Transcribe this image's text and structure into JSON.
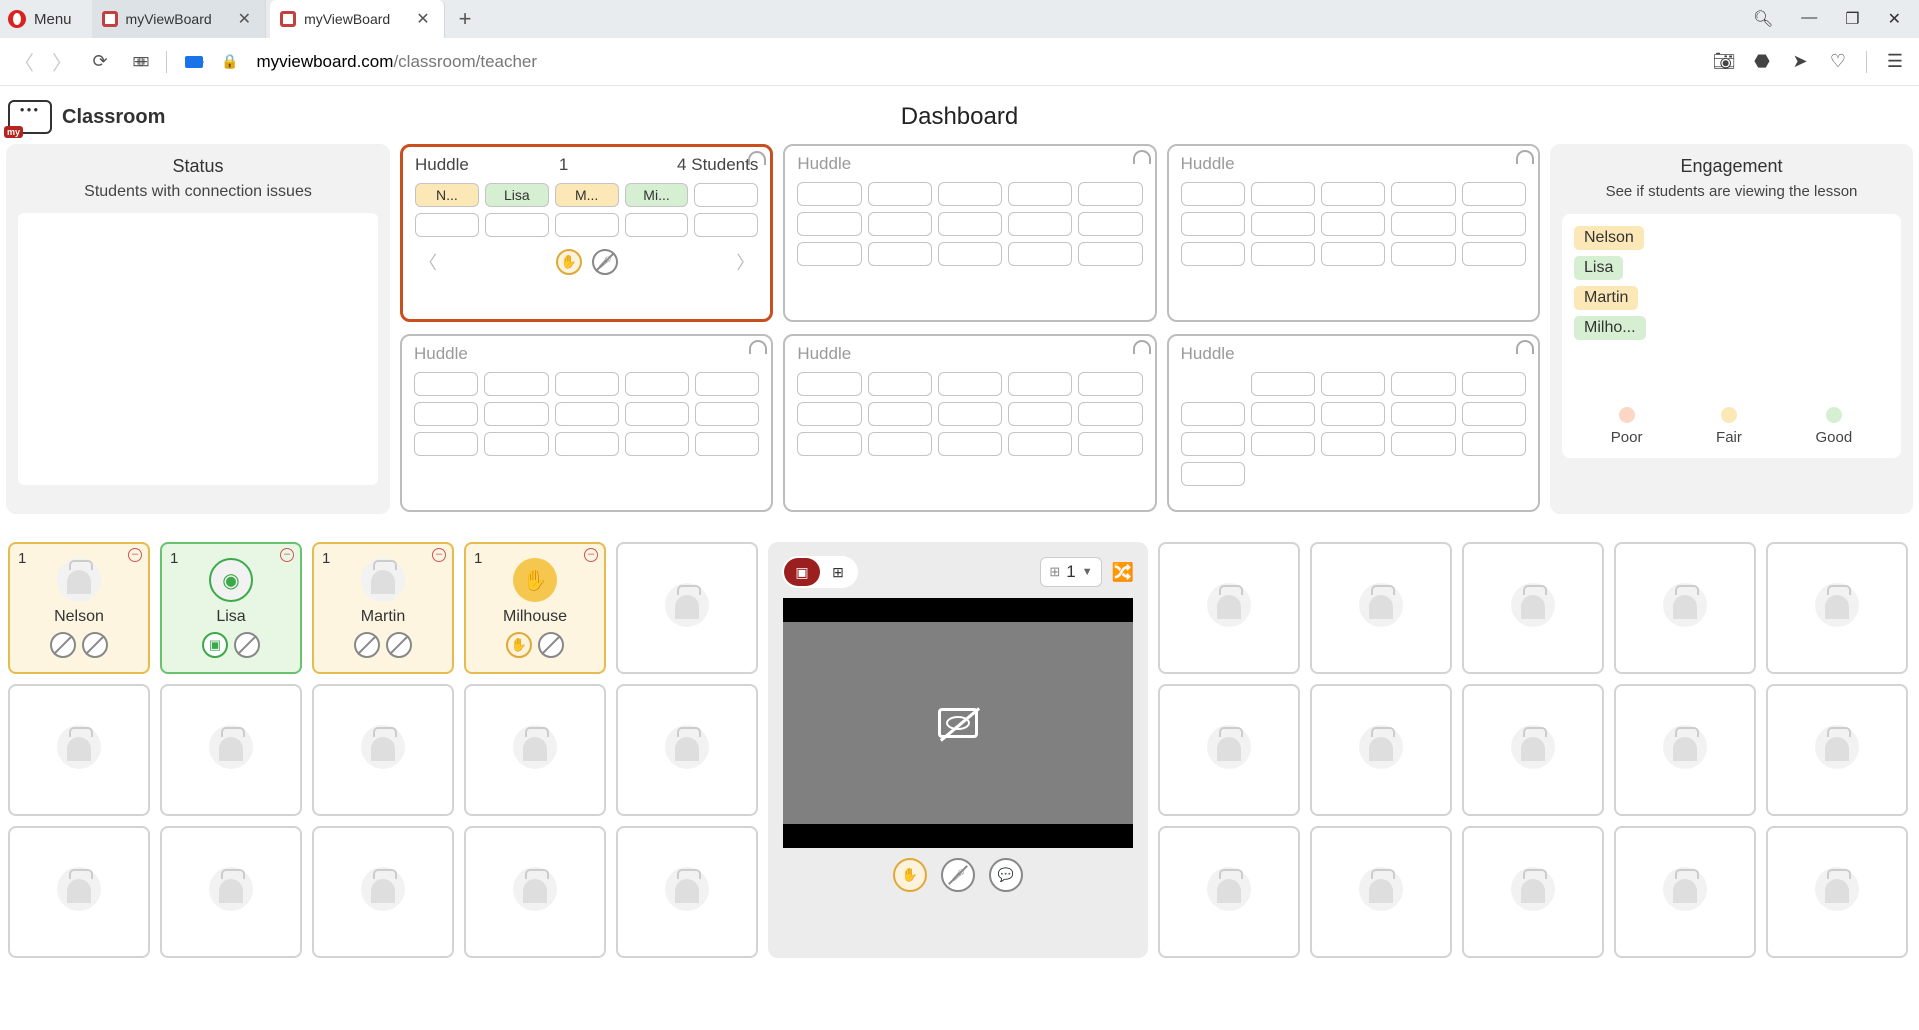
{
  "browser": {
    "menu": "Menu",
    "tabs": [
      {
        "title": "myViewBoard",
        "active": false
      },
      {
        "title": "myViewBoard",
        "active": true
      }
    ],
    "url_host": "myviewboard.com",
    "url_path": "/classroom/teacher"
  },
  "app": {
    "brand": "Classroom",
    "title": "Dashboard"
  },
  "status": {
    "heading": "Status",
    "sub": "Students with connection issues"
  },
  "huddles": {
    "active": {
      "label": "Huddle",
      "number": "1",
      "count": "4 Students",
      "slots": [
        "N...",
        "Lisa",
        "M...",
        "Mi..."
      ]
    },
    "inactive_label": "Huddle"
  },
  "engagement": {
    "heading": "Engagement",
    "sub": "See if students are viewing the lesson",
    "students": [
      {
        "name": "Nelson",
        "tone": "yellow"
      },
      {
        "name": "Lisa",
        "tone": "green"
      },
      {
        "name": "Martin",
        "tone": "yellow"
      },
      {
        "name": "Milho...",
        "tone": "green"
      }
    ],
    "legend": {
      "poor": "Poor",
      "fair": "Fair",
      "good": "Good"
    }
  },
  "students_grid": [
    {
      "idx": "1",
      "name": "Nelson",
      "tone": "yellow"
    },
    {
      "idx": "1",
      "name": "Lisa",
      "tone": "green"
    },
    {
      "idx": "1",
      "name": "Martin",
      "tone": "yellow"
    },
    {
      "idx": "1",
      "name": "Milhouse",
      "tone": "yellow"
    }
  ],
  "pod": {
    "count": "1"
  }
}
